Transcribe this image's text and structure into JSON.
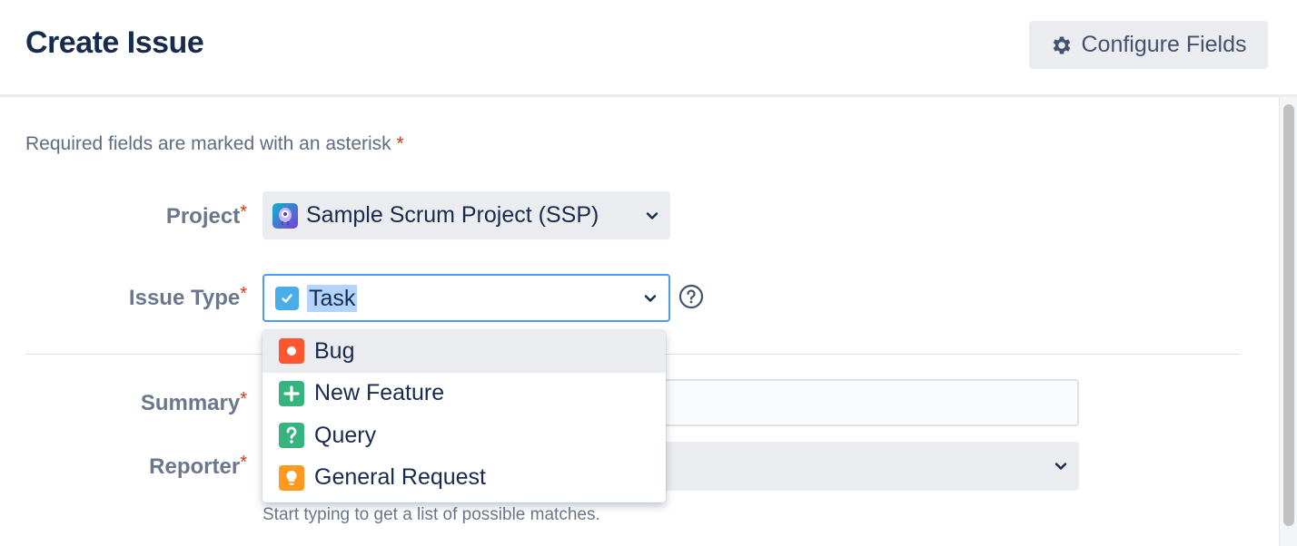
{
  "header": {
    "title": "Create Issue",
    "configure_fields_label": "Configure Fields"
  },
  "form": {
    "required_note": "Required fields are marked with an asterisk",
    "required_mark": "*",
    "project": {
      "label": "Project",
      "value": "Sample Scrum Project (SSP)"
    },
    "issue_type": {
      "label": "Issue Type",
      "value": "Task"
    },
    "summary": {
      "label": "Summary",
      "value": ""
    },
    "reporter": {
      "label": "Reporter",
      "value": "",
      "hint": "Start typing to get a list of possible matches."
    }
  },
  "issue_type_dropdown": {
    "options": [
      {
        "label": "Bug",
        "icon": "bug-icon",
        "color": "#ff5630",
        "highlighted": true
      },
      {
        "label": "New Feature",
        "icon": "new-feature-icon",
        "color": "#36b37e",
        "highlighted": false
      },
      {
        "label": "Query",
        "icon": "query-icon",
        "color": "#36b37e",
        "highlighted": false
      },
      {
        "label": "General Request",
        "icon": "general-request-icon",
        "color": "#ff991f",
        "highlighted": false
      }
    ]
  },
  "colors": {
    "focus_border": "#4c9aff",
    "task_icon": "#4bade8",
    "asterisk": "#de350b"
  }
}
